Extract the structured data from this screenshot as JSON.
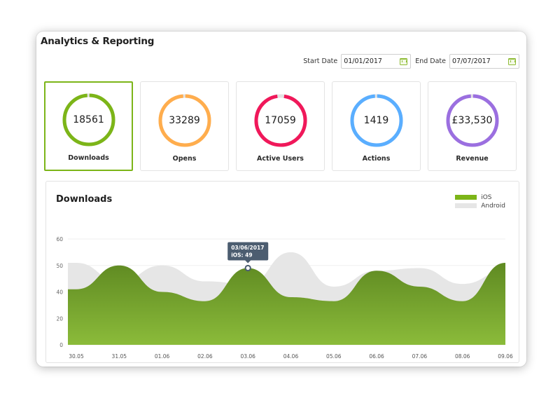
{
  "window": {
    "title": "Analytics & Reporting"
  },
  "filters": {
    "start_label": "Start Date",
    "start_value": "01/01/2017",
    "end_label": "End Date",
    "end_value": "07/07/2017",
    "calendar_icon": "calendar-icon"
  },
  "metrics": [
    {
      "value": "18561",
      "label": "Downloads",
      "color": "#7cb518",
      "fill": 0.99,
      "active": true
    },
    {
      "value": "33289",
      "label": "Opens",
      "color": "#ffad4d",
      "fill": 0.99,
      "active": false
    },
    {
      "value": "17059",
      "label": "Active Users",
      "color": "#f0185a",
      "fill": 0.96,
      "active": false
    },
    {
      "value": "1419",
      "label": "Actions",
      "color": "#5aaeff",
      "fill": 0.99,
      "active": false
    },
    {
      "value": "£33,530",
      "label": "Revenue",
      "color": "#9b6fe0",
      "fill": 0.99,
      "active": false
    }
  ],
  "colors": {
    "accent": "#7cb518",
    "ring_track": "#e3e3e3",
    "tooltip_bg": "#4c5d70"
  },
  "chart_data": {
    "type": "area",
    "title": "Downloads",
    "categories": [
      "30.05",
      "31.05",
      "01.06",
      "02.06",
      "03.06",
      "04.06",
      "05.06",
      "06.06",
      "07.06",
      "08.06",
      "09.06"
    ],
    "y_ticks": [
      0,
      20,
      40,
      50,
      60
    ],
    "ylim": [
      0,
      60
    ],
    "grid": true,
    "legend_position": "top-right",
    "series": [
      {
        "name": "iOS",
        "color": "#7cb518",
        "values": [
          41,
          50,
          40,
          33,
          49,
          36,
          33,
          48,
          42,
          33,
          51
        ]
      },
      {
        "name": "Android",
        "color": "#e6e6e6",
        "values": [
          51,
          44,
          50,
          44,
          43,
          55,
          42,
          48,
          49,
          43,
          48
        ]
      }
    ],
    "tooltip": {
      "date": "03/06/2017",
      "text": "iOS: 49",
      "category": "03.06",
      "series": "iOS"
    }
  }
}
